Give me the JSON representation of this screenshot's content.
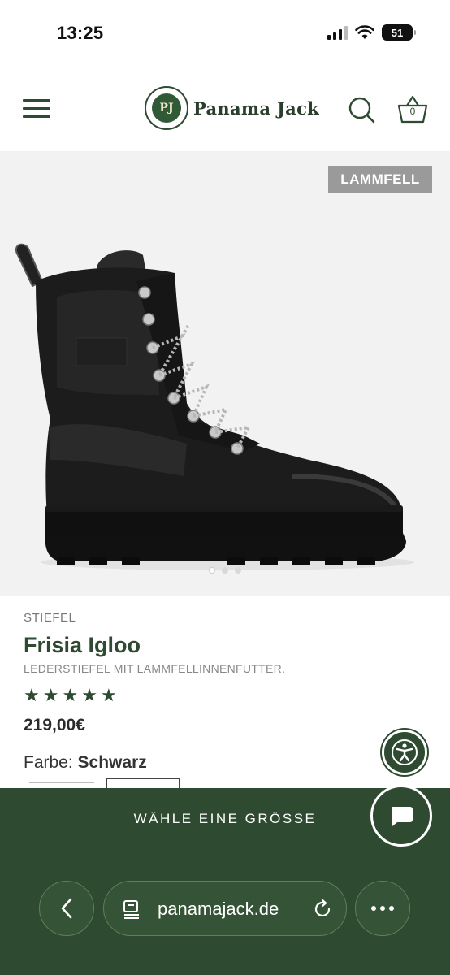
{
  "status_bar": {
    "time": "13:25",
    "battery": "51"
  },
  "header": {
    "brand": "Panama Jack",
    "logo_initial": "PJ",
    "cart_count": "0"
  },
  "product": {
    "badge": "LAMMFELL",
    "category": "STIEFEL",
    "title": "Frisia Igloo",
    "subtitle": "LEDERSTIEFEL MIT LAMMFELLINNENFUTTER.",
    "rating_stars": 5,
    "price": "219,00€",
    "color_label": "Farbe:",
    "color_value": "Schwarz",
    "image_slide_index": 1,
    "image_slide_count": 3
  },
  "cta": {
    "size_button": "WÄHLE EINE GRÖSSE"
  },
  "browser": {
    "url": "panamajack.de"
  },
  "colors": {
    "brand_green": "#2e4a30",
    "badge_gray": "#9a9a9a",
    "image_bg": "#f2f2f2"
  },
  "icons": [
    "hamburger-menu-icon",
    "search-icon",
    "basket-icon",
    "star-icon",
    "accessibility-icon",
    "chat-icon",
    "back-arrow-icon",
    "page-icon",
    "reload-icon",
    "more-icon"
  ]
}
